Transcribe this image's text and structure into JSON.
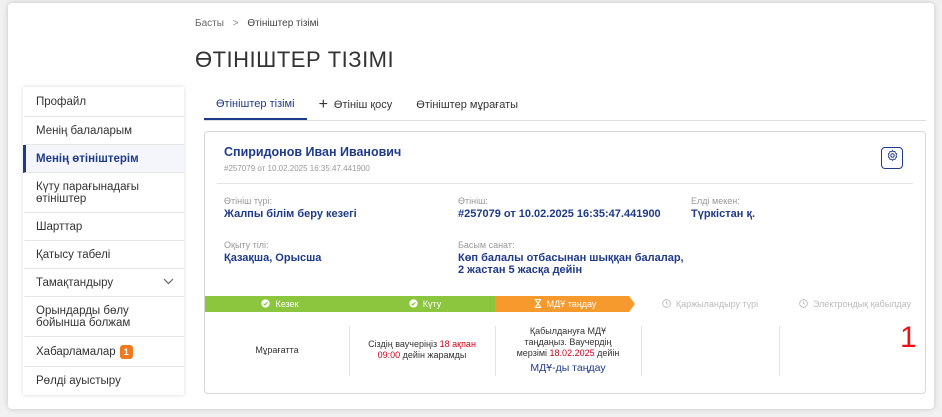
{
  "breadcrumb": {
    "home": "Басты",
    "separator": ">",
    "current": "Өтініштер тізімі"
  },
  "page_title": "ӨТІНІШТЕР ТІЗІМІ",
  "sidebar": {
    "items": [
      {
        "label": "Профайл"
      },
      {
        "label": "Менің балаларым"
      },
      {
        "label": "Менің өтініштерім",
        "active": true
      },
      {
        "label": "Күту парағынадағы өтініштер"
      },
      {
        "label": "Шарттар"
      },
      {
        "label": "Қатысу табелі"
      },
      {
        "label": "Тамақтандыру"
      },
      {
        "label": "Орындарды бөлу бойынша болжам"
      },
      {
        "label": "Хабарламалар",
        "badge": "1"
      },
      {
        "label": "Рөлді ауыстыру"
      }
    ]
  },
  "tabs": [
    {
      "label": "Өтініштер тізімі",
      "active": true
    },
    {
      "label": "Өтініш қосу",
      "icon": "plus-icon"
    },
    {
      "label": "Өтініштер мұрағаты"
    }
  ],
  "card": {
    "name": "Спиридонов Иван Иванович",
    "subtitle": "#257079 от 10.02.2025 16:35:47.441900",
    "fields": {
      "type_label": "Өтініш түрі:",
      "type_value": "Жалпы білім беру кезегі",
      "app_label": "Өтініш:",
      "app_value": "#257079 от 10.02.2025 16:35:47.441900",
      "locality_label": "Елді мекен:",
      "locality_value": "Түркістан қ.",
      "lang_label": "Оқыту тілі:",
      "lang_value": "Қазақша, Орысша",
      "priority_label": "Басым санат:",
      "priority_value_1": "Көп балалы отбасынан шыққан балалар,",
      "priority_value_2": "2 жастан 5 жасқа дейін"
    },
    "steps": [
      {
        "label": "Кезек",
        "status": "done",
        "icon": "check-circle-icon"
      },
      {
        "label": "Күту",
        "status": "done",
        "icon": "check-circle-icon"
      },
      {
        "label": "МДҰ таңдау",
        "status": "current",
        "icon": "hourglass-icon"
      },
      {
        "label": "Қаржыландыру түрі",
        "status": "pending",
        "icon": "clock-icon"
      },
      {
        "label": "Электрондық қабылдау",
        "status": "pending",
        "icon": "clock-icon"
      }
    ],
    "cells": {
      "archive": "Мұрағатта",
      "voucher_prefix": "Сіздің ваучеріңіз",
      "voucher_date": "18 ақпан 09:00",
      "voucher_suffix": "дейін жарамды",
      "accept_prefix": "Қабылдануға МДҰ таңдаңыз. Ваучердің мерзімі",
      "accept_date": "18.02.2025",
      "accept_suffix": "дейін",
      "accept_link": "МДҰ-ды таңдау",
      "counter": "1"
    },
    "colors": {
      "done": "#8cc63f",
      "current": "#f79a2e",
      "accent": "#1e3a8a",
      "alert": "#d0021b"
    }
  }
}
